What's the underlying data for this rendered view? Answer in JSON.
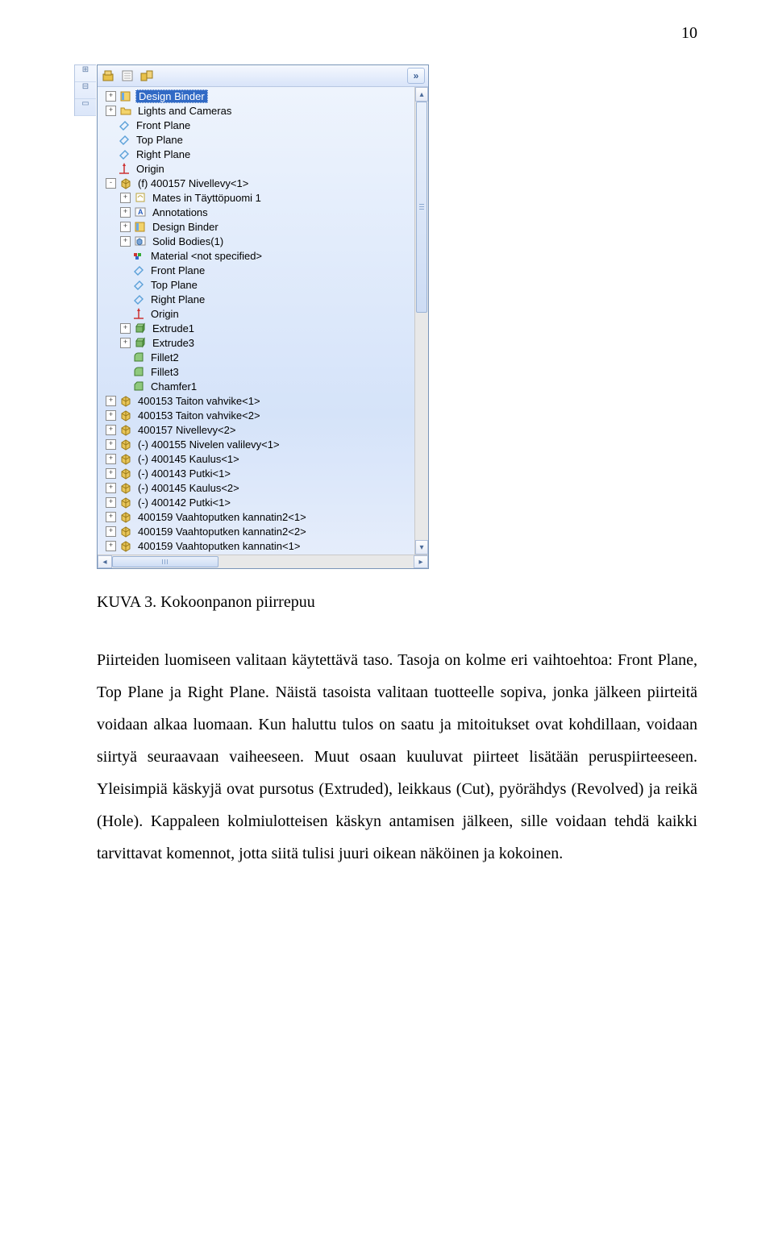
{
  "page_number": "10",
  "caption": "KUVA 3. Kokoonpanon piirrepuu",
  "paragraph": "Piirteiden luomiseen valitaan käytettävä taso. Tasoja on kolme eri vaihtoehtoa: Front Plane, Top Plane ja Right Plane. Näistä tasoista valitaan tuotteelle sopiva, jonka jälkeen piirteitä voidaan alkaa luomaan. Kun haluttu tulos on saatu ja mitoitukset ovat kohdillaan, voidaan siirtyä seuraavaan vaiheeseen. Muut osaan kuuluvat piirteet lisätään peruspiirteeseen. Yleisimpiä käskyjä ovat pursotus (Extruded), leikkaus (Cut), pyörähdys (Revolved) ja reikä (Hole). Kappaleen kolmiulotteisen käskyn antamisen jälkeen, sille voidaan tehdä kaikki tarvittavat komennot, jotta siitä tulisi juuri oikean näköinen ja kokoinen.",
  "tree": {
    "items": [
      {
        "indent": 0,
        "toggle": "+",
        "icon": "binder",
        "label": "Design Binder",
        "selected": true
      },
      {
        "indent": 0,
        "toggle": "+",
        "icon": "folder-y",
        "label": "Lights and Cameras"
      },
      {
        "indent": 0,
        "toggle": "",
        "icon": "plane",
        "label": "Front Plane"
      },
      {
        "indent": 0,
        "toggle": "",
        "icon": "plane",
        "label": "Top Plane"
      },
      {
        "indent": 0,
        "toggle": "",
        "icon": "plane",
        "label": "Right Plane"
      },
      {
        "indent": 0,
        "toggle": "",
        "icon": "origin",
        "label": "Origin"
      },
      {
        "indent": 0,
        "toggle": "-",
        "icon": "part",
        "label": "(f) 400157 Nivellevy<1>"
      },
      {
        "indent": 1,
        "toggle": "+",
        "icon": "mates",
        "label": "Mates in Täyttöpuomi 1"
      },
      {
        "indent": 1,
        "toggle": "+",
        "icon": "annot",
        "label": "Annotations"
      },
      {
        "indent": 1,
        "toggle": "+",
        "icon": "binder",
        "label": "Design Binder"
      },
      {
        "indent": 1,
        "toggle": "+",
        "icon": "solid",
        "label": "Solid Bodies(1)"
      },
      {
        "indent": 1,
        "toggle": "",
        "icon": "material",
        "label": "Material <not specified>"
      },
      {
        "indent": 1,
        "toggle": "",
        "icon": "plane",
        "label": "Front Plane"
      },
      {
        "indent": 1,
        "toggle": "",
        "icon": "plane",
        "label": "Top Plane"
      },
      {
        "indent": 1,
        "toggle": "",
        "icon": "plane",
        "label": "Right Plane"
      },
      {
        "indent": 1,
        "toggle": "",
        "icon": "origin",
        "label": "Origin"
      },
      {
        "indent": 1,
        "toggle": "+",
        "icon": "extrude",
        "label": "Extrude1"
      },
      {
        "indent": 1,
        "toggle": "+",
        "icon": "extrude",
        "label": "Extrude3"
      },
      {
        "indent": 1,
        "toggle": "",
        "icon": "fillet",
        "label": "Fillet2"
      },
      {
        "indent": 1,
        "toggle": "",
        "icon": "fillet",
        "label": "Fillet3"
      },
      {
        "indent": 1,
        "toggle": "",
        "icon": "chamfer",
        "label": "Chamfer1"
      },
      {
        "indent": 0,
        "toggle": "+",
        "icon": "part",
        "label": "400153 Taiton vahvike<1>"
      },
      {
        "indent": 0,
        "toggle": "+",
        "icon": "part",
        "label": "400153 Taiton vahvike<2>"
      },
      {
        "indent": 0,
        "toggle": "+",
        "icon": "part",
        "label": "400157 Nivellevy<2>"
      },
      {
        "indent": 0,
        "toggle": "+",
        "icon": "part",
        "label": "(-) 400155 Nivelen valilevy<1>"
      },
      {
        "indent": 0,
        "toggle": "+",
        "icon": "part",
        "label": "(-) 400145 Kaulus<1>"
      },
      {
        "indent": 0,
        "toggle": "+",
        "icon": "part",
        "label": "(-) 400143 Putki<1>"
      },
      {
        "indent": 0,
        "toggle": "+",
        "icon": "part",
        "label": "(-) 400145 Kaulus<2>"
      },
      {
        "indent": 0,
        "toggle": "+",
        "icon": "part",
        "label": "(-) 400142 Putki<1>"
      },
      {
        "indent": 0,
        "toggle": "+",
        "icon": "part",
        "label": "400159 Vaahtoputken kannatin2<1>"
      },
      {
        "indent": 0,
        "toggle": "+",
        "icon": "part",
        "label": "400159 Vaahtoputken kannatin2<2>"
      },
      {
        "indent": 0,
        "toggle": "+",
        "icon": "part",
        "label": "400159 Vaahtoputken kannatin<1>"
      }
    ]
  }
}
